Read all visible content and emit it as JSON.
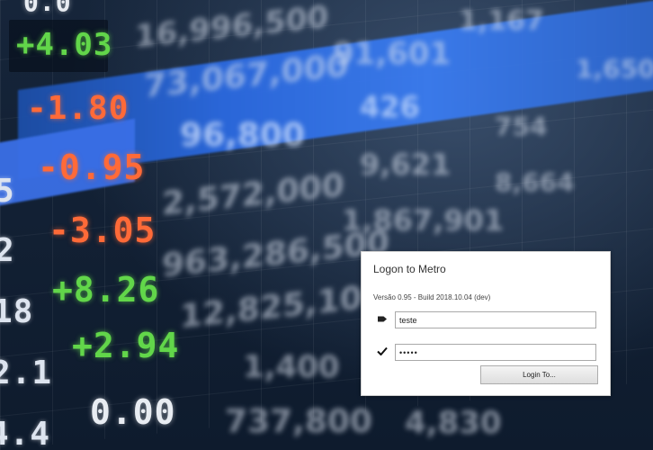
{
  "backdrop": {
    "left_column": [
      "5",
      "2",
      "18",
      "2.1",
      "4.4"
    ],
    "change_column": [
      "+4.03",
      "-1.80",
      "-0.95",
      "-3.05",
      "+8.26",
      "+2.94",
      "0.00"
    ],
    "top_partial": "0.0",
    "blurred_values": [
      "16,996,500",
      "73,067,000",
      "96,800",
      "2,572,000",
      "963,286,500",
      "12,825,100",
      "1,400",
      "737,800",
      "91,601",
      "1,167",
      "426",
      "9,621",
      "1,867,901",
      "754",
      "8,664",
      "4,830",
      "1,650"
    ]
  },
  "dialog": {
    "title": "Logon to Metro",
    "version": "Versão 0.95 - Build 2018.10.04 (dev)",
    "user_icon": "tag-icon",
    "username_value": "teste",
    "password_icon": "check-icon",
    "password_value": "•••••",
    "login_button": "Login To..."
  }
}
